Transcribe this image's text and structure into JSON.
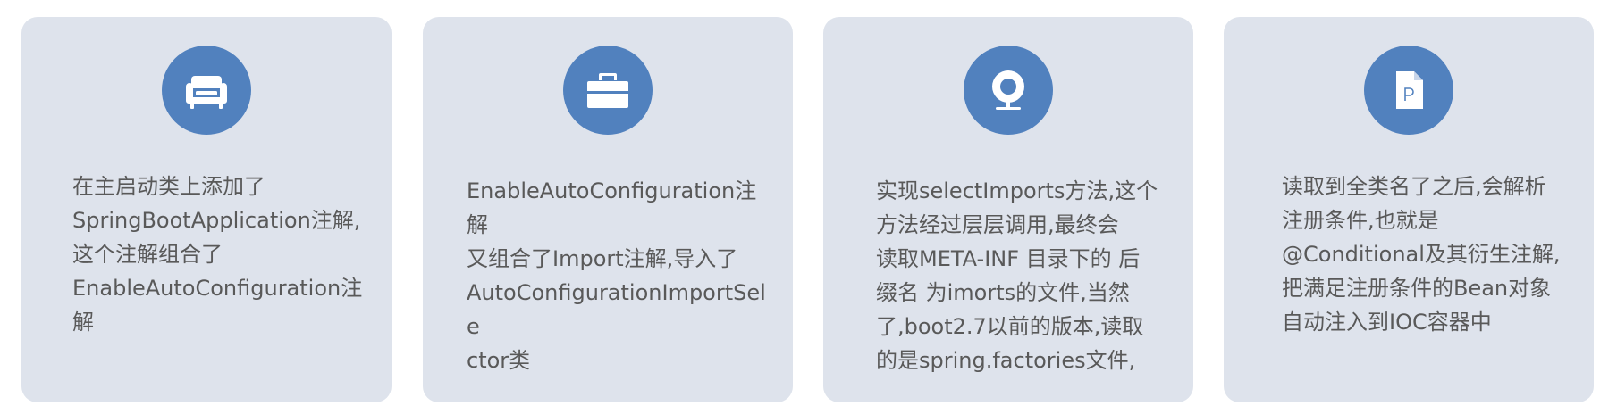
{
  "cards": [
    {
      "icon": "armchair-icon",
      "text": "在主启动类上添加了\nSpringBootApplication注解,\n这个注解组合了\nEnableAutoConfiguration注\n解"
    },
    {
      "icon": "toolbox-icon",
      "text": "EnableAutoConfiguration注解\n又组合了Import注解,导入了\nAutoConfigurationImportSele\nctor类"
    },
    {
      "icon": "webcam-icon",
      "text": "实现selectImports方法,这个\n方法经过层层调用,最终会\n读取META-INF 目录下的 后\n缀名 为imorts的文件,当然\n了,boot2.7以前的版本,读取\n的是spring.factories文件,"
    },
    {
      "icon": "document-p-icon",
      "text": "读取到全类名了之后,会解析\n注册条件,也就是\n@Conditional及其衍生注解,\n把满足注册条件的Bean对象\n自动注入到IOC容器中"
    }
  ],
  "colors": {
    "card_background": "#dee3ec",
    "icon_circle": "#5181be",
    "text": "#595959",
    "icon_glyph": "#ffffff"
  }
}
